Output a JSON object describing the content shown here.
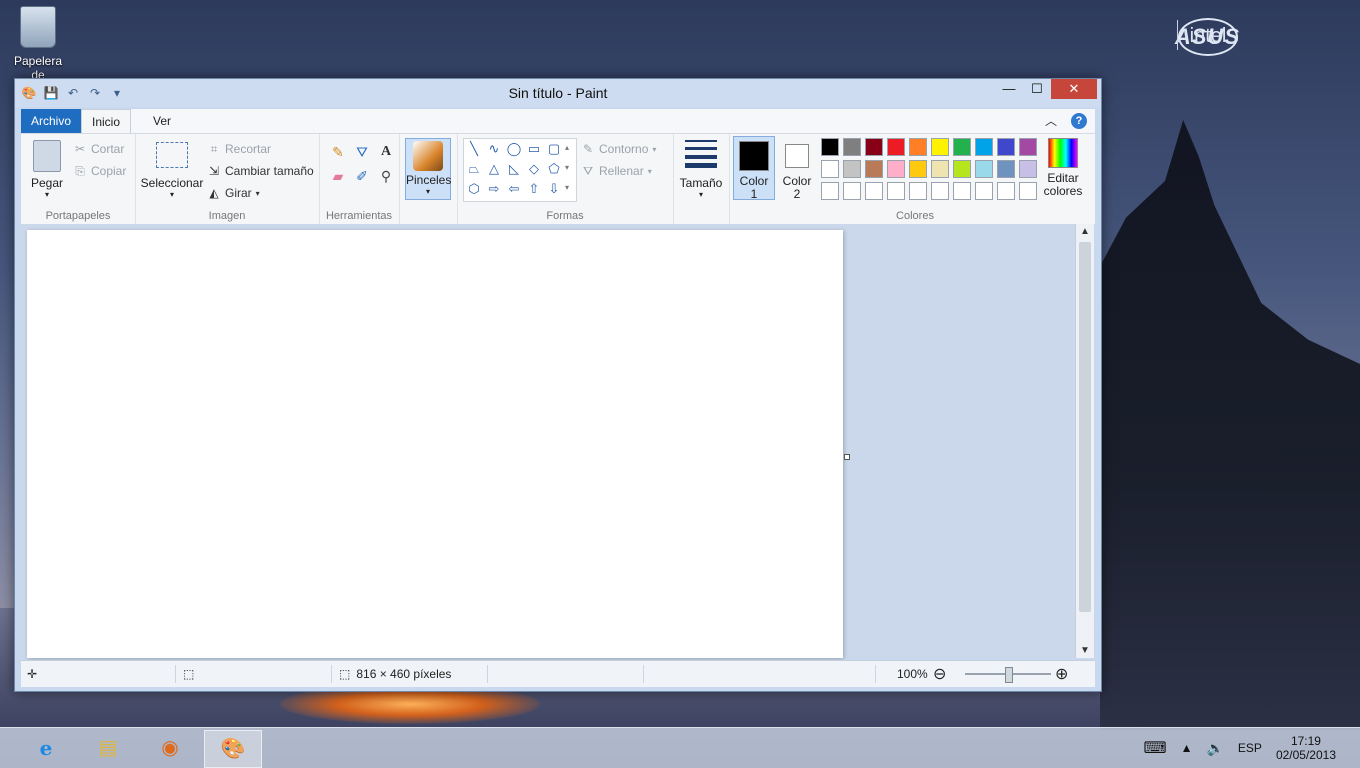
{
  "desktop": {
    "recycle_bin_label": "Papelera de",
    "brand_asus": "ASUS",
    "brand_intel": "intel"
  },
  "window": {
    "title": "Sin título - Paint",
    "tabs": {
      "file": "Archivo",
      "home": "Inicio",
      "view": "Ver"
    },
    "caption_buttons": {
      "minimize": "—",
      "maximize": "☐",
      "close": "✕"
    }
  },
  "ribbon": {
    "clipboard": {
      "label": "Portapapeles",
      "paste": "Pegar",
      "cut": "Cortar",
      "copy": "Copiar"
    },
    "image": {
      "label": "Imagen",
      "select": "Seleccionar",
      "crop": "Recortar",
      "resize": "Cambiar tamaño",
      "rotate": "Girar"
    },
    "tools": {
      "label": "Herramientas"
    },
    "brushes": {
      "label": "Pinceles"
    },
    "shapes": {
      "label": "Formas",
      "outline": "Contorno",
      "fill": "Rellenar"
    },
    "size": {
      "label": "Tamaño"
    },
    "colors": {
      "label": "Colores",
      "color1": "Color 1",
      "color2": "Color 2",
      "edit": "Editar colores",
      "palette_row1": [
        "#000000",
        "#7f7f7f",
        "#880015",
        "#ed1c24",
        "#ff7f27",
        "#fff200",
        "#22b14c",
        "#00a2e8",
        "#3f48cc",
        "#a349a4"
      ],
      "palette_row2": [
        "#ffffff",
        "#c3c3c3",
        "#b97a57",
        "#ffaec9",
        "#ffc90e",
        "#efe4b0",
        "#b5e61d",
        "#99d9ea",
        "#7092be",
        "#c8bfe7"
      ]
    }
  },
  "status": {
    "canvas_size": "816 × 460 píxeles",
    "zoom": "100%"
  },
  "taskbar": {
    "language": "ESP",
    "time": "17:19",
    "date": "02/05/2013"
  }
}
